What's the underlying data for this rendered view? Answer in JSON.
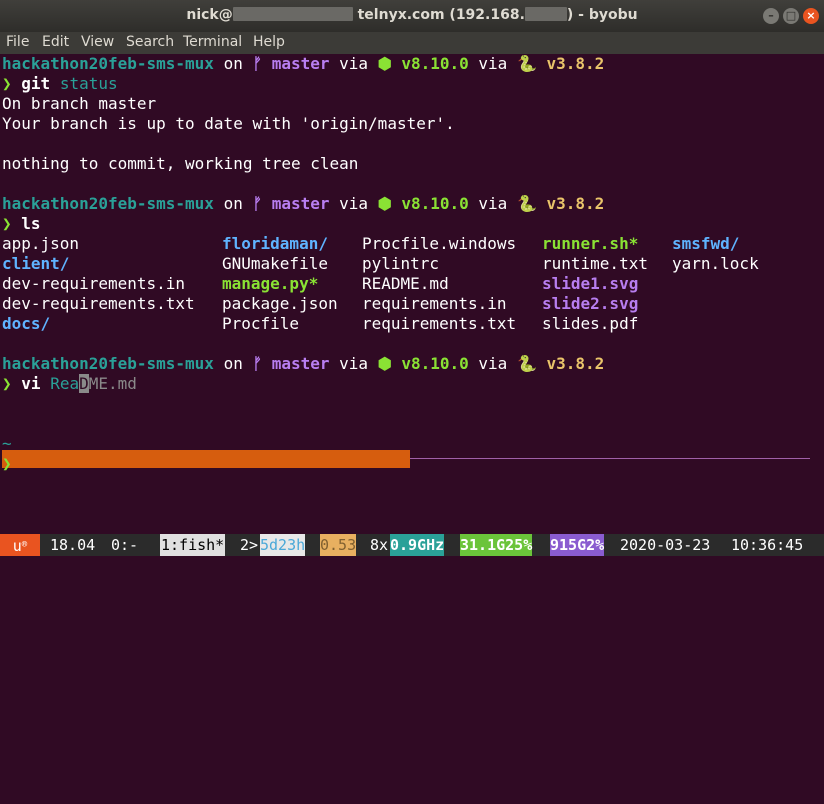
{
  "window": {
    "title_prefix": "nick@",
    "title_host": "telnyx.com (192.168.",
    "title_suffix": ") - byobu",
    "min_btn": "–",
    "max_btn": "□",
    "close_btn": "×"
  },
  "menu": [
    "File",
    "Edit",
    "View",
    "Search",
    "Terminal",
    "Help"
  ],
  "prompt": {
    "dir": "hackathon20feb-sms-mux",
    "on": "on",
    "branch_icon": "ᚠ",
    "branch": "master",
    "via": "via",
    "node_icon": "⬢",
    "node_version": "v8.10.0",
    "via2": "via",
    "python_icon": "🐍",
    "python_version": "v3.8.2",
    "arrow": "❯"
  },
  "cmd1": {
    "cmd": "git",
    "args": "status"
  },
  "git_output": [
    "On branch master",
    "Your branch is up to date with 'origin/master'.",
    "",
    "nothing to commit, working tree clean"
  ],
  "cmd2": {
    "cmd": "ls"
  },
  "ls": {
    "row1": [
      "app.json",
      "floridaman/",
      "Procfile.windows",
      "runner.sh*",
      "smsfwd/"
    ],
    "row2": [
      "client/",
      "GNUmakefile",
      "pylintrc",
      "runtime.txt",
      "yarn.lock"
    ],
    "row3": [
      "dev-requirements.in",
      "manage.py*",
      "README.md",
      "slide1.svg"
    ],
    "row4": [
      "dev-requirements.txt",
      "package.json",
      "requirements.in",
      "slide2.svg"
    ],
    "row5": [
      "docs/",
      "Procfile",
      "requirements.txt",
      "slides.pdf"
    ]
  },
  "cmd3": {
    "cmd": "vi",
    "typed_before": "Rea",
    "cursor_char": "D",
    "suggest_after": "ME.md"
  },
  "vim_tilde": "~",
  "final_arrow": "❯",
  "statusbar": {
    "logo": "u",
    "release": "18.04",
    "session": "0:-",
    "window": "1:fish*",
    "uptime_prefix": "2>",
    "uptime": "5d23h",
    "load": "0.53",
    "cpu_count": "8x",
    "cpu_freq": "0.9GHz",
    "mem": "31.1G25%",
    "disk": "915G2%",
    "date": "2020-03-23",
    "time": "10:36:45"
  },
  "colors": {
    "background": "#300a24",
    "accent_orange": "#d65d0e",
    "prompt_cyan": "#2aa198",
    "branch_purple": "#b87ef0",
    "node_green": "#8ae234",
    "python_yellow": "#e9c46a"
  }
}
